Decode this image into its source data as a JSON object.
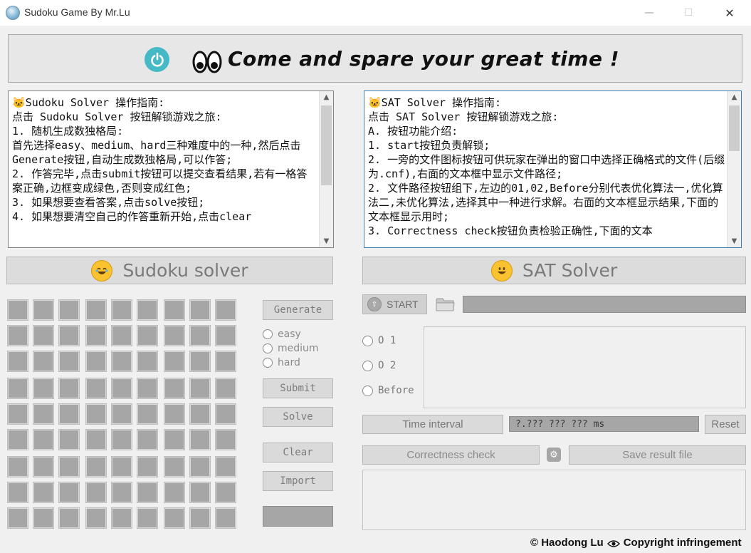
{
  "window": {
    "title": "Sudoku Game By Mr.Lu",
    "minimize": "—",
    "maximize": "☐",
    "close": "✕"
  },
  "banner": {
    "text": "Come and spare your great time !",
    "power_icon": "power-icon",
    "eyes_icon": "eyes-icon"
  },
  "left_panel": {
    "text": "🐱Sudoku Solver 操作指南:\n点击 Sudoku Solver 按钮解锁游戏之旅:\n1. 随机生成数独格局:\n首先选择easy、medium、hard三种难度中的一种,然后点击Generate按钮,自动生成数独格局,可以作答;\n2. 作答完毕,点击submit按钮可以提交查看结果,若有一格答案正确,边框变成绿色,否则变成红色;\n3. 如果想要查看答案,点击solve按钮;\n4. 如果想要清空自己的作答重新开始,点击clear"
  },
  "right_panel": {
    "text": "🐱SAT Solver 操作指南:\n点击 SAT Solver 按钮解锁游戏之旅:\nA. 按钮功能介绍:\n1. start按钮负责解锁;\n2. 一旁的文件图标按钮可供玩家在弹出的窗口中选择正确格式的文件(后缀为.cnf),右面的文本框中显示文件路径;\n2. 文件路径按钮组下,左边的01,02,Before分别代表优化算法一,优化算法二,未优化算法,选择其中一种进行求解。右面的文本框显示结果,下面的文本框显示用时;\n3. Correctness check按钮负责检验正确性,下面的文本"
  },
  "sudoku": {
    "header": "Sudoku solver",
    "header_emoji": "😂",
    "buttons": {
      "generate": "Generate",
      "submit": "Submit",
      "solve": "Solve",
      "clear": "Clear",
      "import": "Import"
    },
    "difficulty": [
      "easy",
      "medium",
      "hard"
    ]
  },
  "sat": {
    "header": "SAT Solver",
    "header_emoji": "😀",
    "start": "START",
    "path_value": "",
    "algorithms": [
      "O 1",
      "O 2",
      "Before"
    ],
    "time_interval_label": "Time interval",
    "time_value": "?.??? ??? ??? ms",
    "reset": "Reset",
    "correctness_check": "Correctness check",
    "save_result": "Save result file"
  },
  "footer": {
    "author": "© Haodong Lu",
    "copyright": "Copyright infringement"
  },
  "colors": {
    "window_bg": "#f0f0f0",
    "cell": "#a6a6a6",
    "power": "#45b9c5",
    "header_text": "#7a7a7a"
  }
}
